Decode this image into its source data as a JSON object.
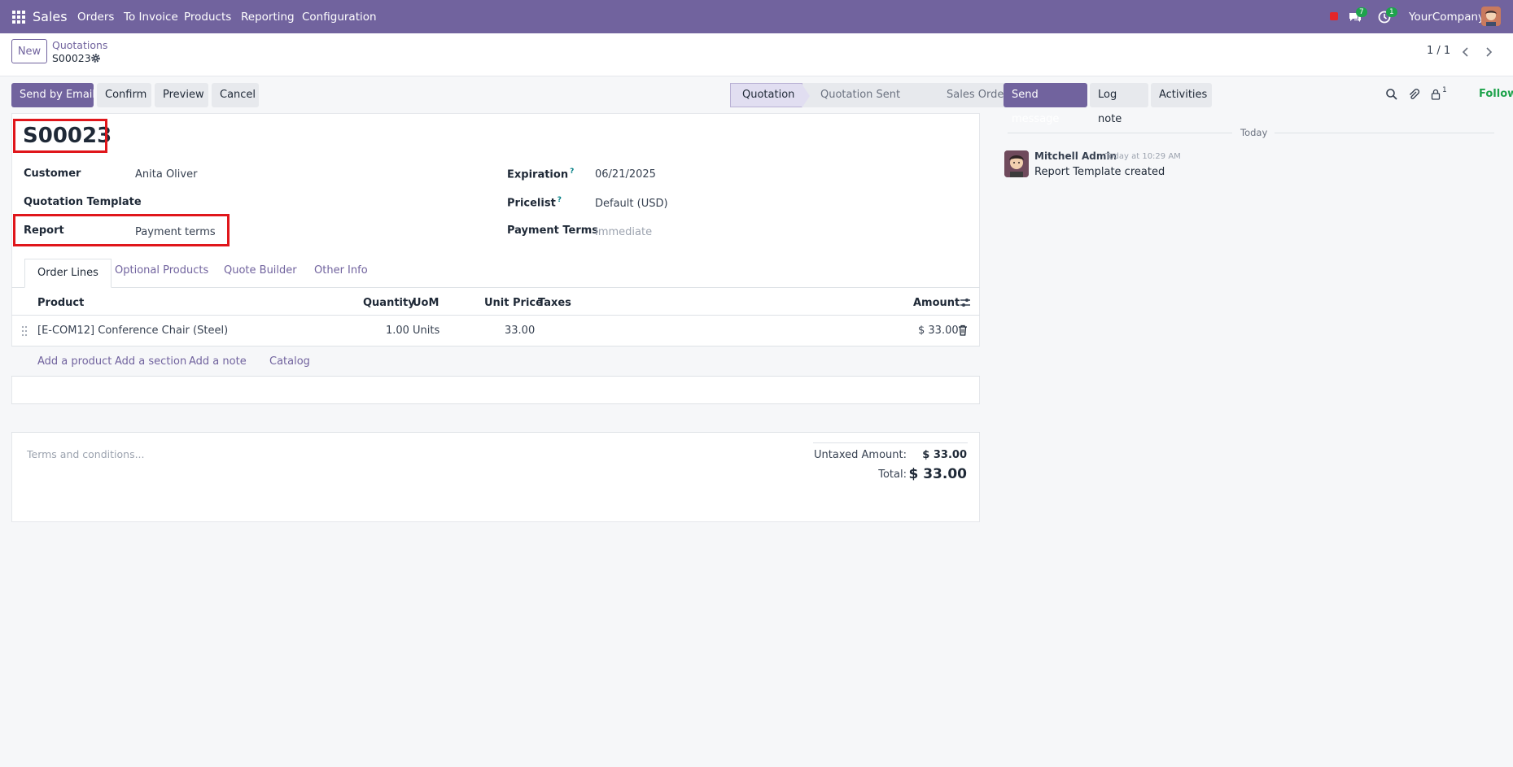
{
  "navbar": {
    "app_name": "Sales",
    "menu": [
      "Orders",
      "To Invoice",
      "Products",
      "Reporting",
      "Configuration"
    ],
    "messages_badge": "7",
    "activities_badge": "1",
    "company": "YourCompany"
  },
  "control_panel": {
    "new_label": "New",
    "breadcrumb_parent": "Quotations",
    "breadcrumb_current": "S00023",
    "pager": "1 / 1"
  },
  "actions": {
    "send_by_email": "Send by Email",
    "confirm": "Confirm",
    "preview": "Preview",
    "cancel": "Cancel"
  },
  "statusbar": {
    "stages": [
      "Quotation",
      "Quotation Sent",
      "Sales Order"
    ],
    "active": "Quotation"
  },
  "form": {
    "name": "S00023",
    "customer_label": "Customer",
    "customer_value": "Anita Oliver",
    "quotation_template_label": "Quotation Template",
    "quotation_template_value": "",
    "report_label": "Report",
    "report_value": "Payment terms",
    "expiration_label": "Expiration",
    "expiration_value": "06/21/2025",
    "pricelist_label": "Pricelist",
    "pricelist_value": "Default (USD)",
    "payment_terms_label": "Payment Terms",
    "payment_terms_placeholder": "Immediate",
    "help_mark": "?"
  },
  "tabs": [
    "Order Lines",
    "Optional Products",
    "Quote Builder",
    "Other Info"
  ],
  "order_lines": {
    "columns": {
      "product": "Product",
      "quantity": "Quantity",
      "uom": "UoM",
      "unit_price": "Unit Price",
      "taxes": "Taxes",
      "amount": "Amount"
    },
    "rows": [
      {
        "product": "[E-COM12] Conference Chair (Steel)",
        "quantity": "1.00",
        "uom": "Units",
        "unit_price": "33.00",
        "taxes": "",
        "amount": "$ 33.00"
      }
    ],
    "add_links": {
      "add_product": "Add a product",
      "add_section": "Add a section",
      "add_note": "Add a note",
      "catalog": "Catalog"
    }
  },
  "totals": {
    "terms_placeholder": "Terms and conditions...",
    "untaxed_label": "Untaxed Amount:",
    "untaxed_value": "$ 33.00",
    "total_label": "Total:",
    "total_value": "$ 33.00"
  },
  "chatter": {
    "send_message": "Send message",
    "log_note": "Log note",
    "activities": "Activities",
    "followers_count": "1",
    "following": "Following",
    "date_separator": "Today",
    "messages": [
      {
        "author": "Mitchell Admin",
        "date": "Today at 10:29 AM",
        "body": "Report Template created"
      }
    ]
  },
  "colors": {
    "brand": "#71639e",
    "highlight": "#e0161b",
    "success": "#1ea34c"
  }
}
